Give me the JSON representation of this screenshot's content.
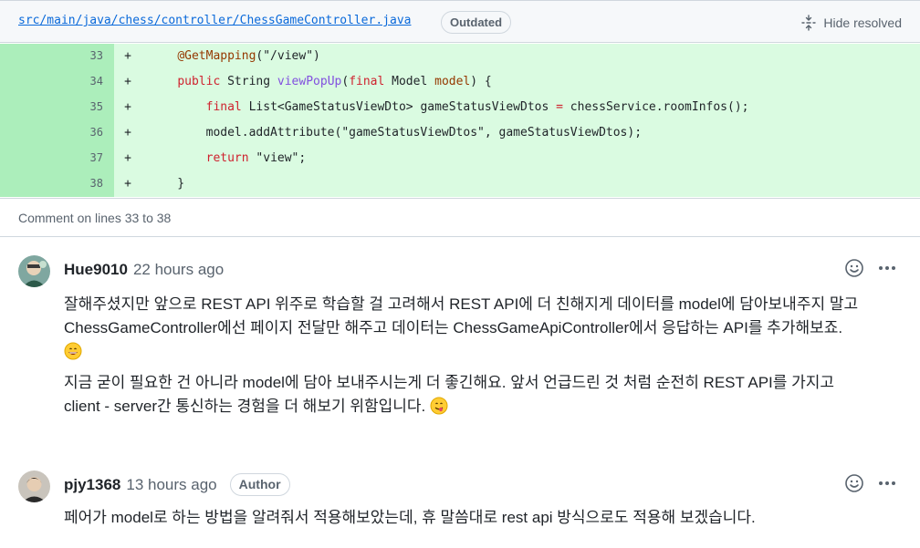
{
  "file_header": {
    "path": "src/main/java/chess/controller/ChessGameController.java",
    "outdated_label": "Outdated",
    "hide_resolved_label": "Hide resolved"
  },
  "code_lines": [
    {
      "line": "33",
      "marker": "+",
      "tokens": [
        {
          "t": "    "
        },
        {
          "t": "@GetMapping",
          "c": "an"
        },
        {
          "t": "(\"/view\")"
        }
      ]
    },
    {
      "line": "34",
      "marker": "+",
      "tokens": [
        {
          "t": "    "
        },
        {
          "t": "public",
          "c": "kw"
        },
        {
          "t": " String "
        },
        {
          "t": "viewPopUp",
          "c": "fn"
        },
        {
          "t": "("
        },
        {
          "t": "final",
          "c": "kw"
        },
        {
          "t": " Model "
        },
        {
          "t": "model",
          "c": "an"
        },
        {
          "t": ") {"
        }
      ]
    },
    {
      "line": "35",
      "marker": "+",
      "tokens": [
        {
          "t": "        "
        },
        {
          "t": "final",
          "c": "kw"
        },
        {
          "t": " List<GameStatusViewDto> "
        },
        {
          "t": "gameStatusViewDtos",
          "c": ""
        },
        {
          "t": " "
        },
        {
          "t": "=",
          "c": "kw"
        },
        {
          "t": " chessService.roomInfos();"
        }
      ]
    },
    {
      "line": "36",
      "marker": "+",
      "tokens": [
        {
          "t": "        model.addAttribute(\"gameStatusViewDtos\", gameStatusViewDtos);"
        }
      ]
    },
    {
      "line": "37",
      "marker": "+",
      "tokens": [
        {
          "t": "        "
        },
        {
          "t": "return",
          "c": "kw"
        },
        {
          "t": " \"view\";"
        }
      ]
    },
    {
      "line": "38",
      "marker": "+",
      "tokens": [
        {
          "t": "    }"
        }
      ]
    }
  ],
  "comment_range": "Comment on lines 33 to 38",
  "comments": [
    {
      "author": "Hue9010",
      "time": "22 hours ago",
      "badge": "",
      "paragraphs": [
        "잘해주셨지만 앞으로 REST API 위주로 학습할 걸 고려해서 REST API에 더 친해지게 데이터를 model에 담아보내주지 말고",
        "ChessGameController에선 페이지 전달만 해주고 데이터는 ChessGameApiController에서 응답하는 API를 추가해보죠.",
        "지금 굳이 필요한 건 아니라 model에 담아 보내주시는게 더 좋긴해요. 앞서 언급드린 것 처럼 순전히 REST API를 가지고",
        "client - server간 통신하는 경험을 더 해보기 위함입니다."
      ]
    },
    {
      "author": "pjy1368",
      "time": "13 hours ago",
      "badge": "Author",
      "paragraphs": [
        "페어가 model로 하는 방법을 알려줘서 적용해보았는데, 휴 말씀대로 rest api 방식으로도 적용해 보겠습니다."
      ]
    }
  ],
  "icons": {
    "hide_resolved": "unfold-icon",
    "reaction": "smiley-icon",
    "more": "kebab-horizontal-icon"
  }
}
